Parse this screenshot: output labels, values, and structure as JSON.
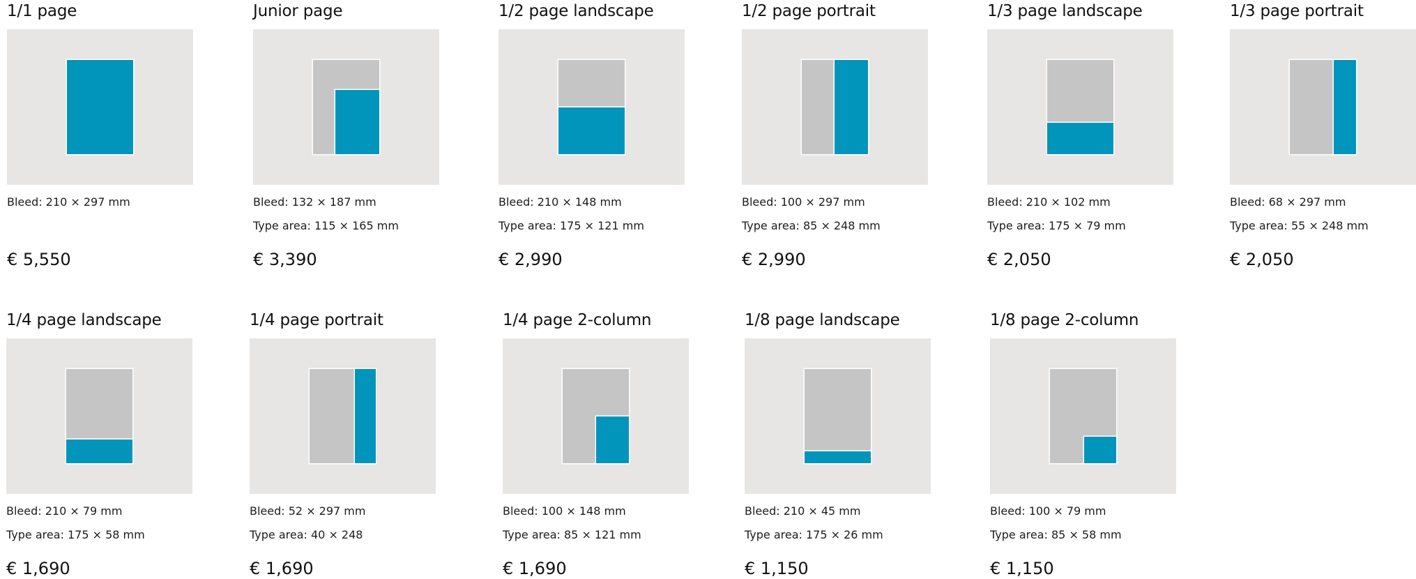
{
  "ads": [
    {
      "title": "1/1 page",
      "bleed": "Bleed: 210 × 297 mm",
      "type_area": "",
      "price": "€ 5,550",
      "placement": "full"
    },
    {
      "title": "Junior page",
      "bleed": "Bleed: 132 × 187 mm",
      "type_area": "Type area: 115 × 165 mm",
      "price": "€ 3,390",
      "placement": "junior"
    },
    {
      "title": "1/2 page landscape",
      "bleed": "Bleed: 210 × 148 mm",
      "type_area": "Type area: 175 × 121 mm",
      "price": "€ 2,990",
      "placement": "half-landscape"
    },
    {
      "title": "1/2 page portrait",
      "bleed": "Bleed: 100 × 297 mm",
      "type_area": "Type area: 85 × 248 mm",
      "price": "€ 2,990",
      "placement": "half-portrait"
    },
    {
      "title": "1/3 page landscape",
      "bleed": "Bleed: 210 × 102 mm",
      "type_area": "Type area: 175 × 79 mm",
      "price": "€ 2,050",
      "placement": "third-landscape"
    },
    {
      "title": "1/3 page portrait",
      "bleed": "Bleed: 68 × 297 mm",
      "type_area": "Type area: 55 × 248 mm",
      "price": "€ 2,050",
      "placement": "third-portrait"
    },
    {
      "title": "1/4 page landscape",
      "bleed": "Bleed: 210 × 79 mm",
      "type_area": "Type area: 175 × 58 mm",
      "price": "€ 1,690",
      "placement": "quarter-landscape"
    },
    {
      "title": "1/4 page portrait",
      "bleed": "Bleed: 52 × 297 mm",
      "type_area": "Type area: 40 × 248",
      "price": "€ 1,690",
      "placement": "quarter-portrait"
    },
    {
      "title": "1/4 page 2-column",
      "bleed": "Bleed: 100 × 148 mm",
      "type_area": "Type area: 85 × 121 mm",
      "price": "€ 1,690",
      "placement": "quarter-2column"
    },
    {
      "title": "1/8 page landscape",
      "bleed": "Bleed: 210 × 45 mm",
      "type_area": "Type area: 175 × 26 mm",
      "price": "€ 1,150",
      "placement": "eighth-landscape"
    },
    {
      "title": "1/8 page 2-column",
      "bleed": "Bleed: 100 × 79 mm",
      "type_area": "Type area: 85 × 58 mm",
      "price": "€ 1,150",
      "placement": "eighth-2column"
    }
  ],
  "colors": {
    "frame": "#e7e6e5",
    "page": "#c4c5c4",
    "ad_highlight": "#0195bc"
  }
}
